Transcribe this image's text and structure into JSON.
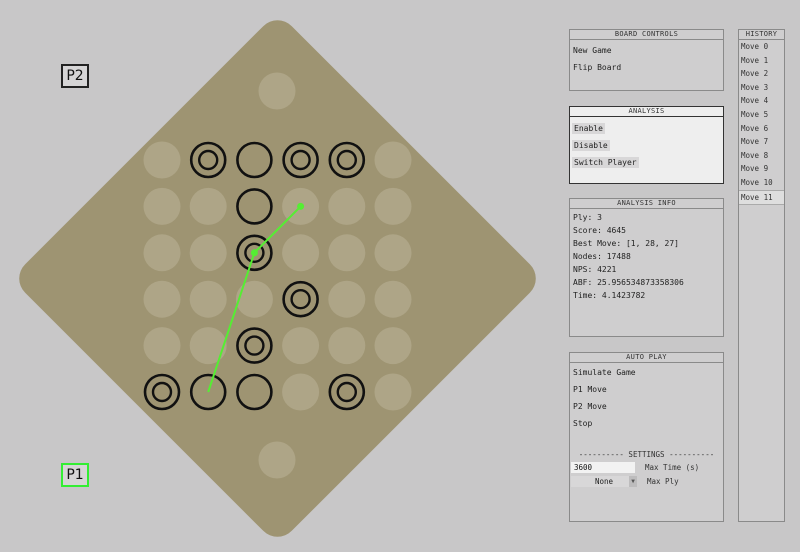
{
  "board": {
    "colors": {
      "board": "#9e9472",
      "empty_hole": "#aea587",
      "piece_stroke": "#111111",
      "move_line": "#55ee33"
    },
    "rows": [
      [
        "empty",
        "double",
        "single",
        "double",
        "double",
        "empty"
      ],
      [
        "empty",
        "empty",
        "single",
        "empty",
        "empty",
        "empty"
      ],
      [
        "empty",
        "empty",
        "double",
        "empty",
        "empty",
        "empty"
      ],
      [
        "empty",
        "empty",
        "empty",
        "double",
        "empty",
        "empty"
      ],
      [
        "empty",
        "empty",
        "double",
        "empty",
        "empty",
        "empty"
      ],
      [
        "double",
        "single",
        "single",
        "empty",
        "double",
        "empty"
      ]
    ],
    "top_goal": "empty",
    "bottom_goal": "empty",
    "arrows": [
      {
        "from": [
          5,
          1
        ],
        "to": [
          2,
          2
        ]
      },
      {
        "from": [
          2,
          2
        ],
        "to": [
          1,
          3
        ]
      }
    ]
  },
  "players": {
    "p2": "P2",
    "p1": "P1"
  },
  "board_controls": {
    "title": "BOARD CONTROLS",
    "new_game": "New Game",
    "flip_board": "Flip Board"
  },
  "analysis": {
    "title": "ANALYSIS",
    "enable": "Enable",
    "disable": "Disable",
    "switch_player": "Switch Player"
  },
  "analysis_info": {
    "title": "ANALYSIS INFO",
    "ply": "Ply: 3",
    "score": "Score: 4645",
    "best_move": "Best Move: [1, 28, 27]",
    "nodes": "Nodes: 17488",
    "nps": "NPS: 4221",
    "abf": "ABF: 25.956534873358306",
    "time": "Time: 4.1423782"
  },
  "auto_play": {
    "title": "AUTO PLAY",
    "simulate": "Simulate Game",
    "p1_move": "P1 Move",
    "p2_move": "P2 Move",
    "stop": "Stop",
    "settings_header": "---------- SETTINGS ----------",
    "max_time_value": "3600",
    "max_time_label": "Max Time (s)",
    "max_ply_value": "None",
    "max_ply_label": "Max Ply"
  },
  "history": {
    "title": "HISTORY",
    "selected_index": 11,
    "items": [
      "Move 0",
      "Move 1",
      "Move 2",
      "Move 3",
      "Move 4",
      "Move 5",
      "Move 6",
      "Move 7",
      "Move 8",
      "Move 9",
      "Move 10",
      "Move 11"
    ]
  }
}
